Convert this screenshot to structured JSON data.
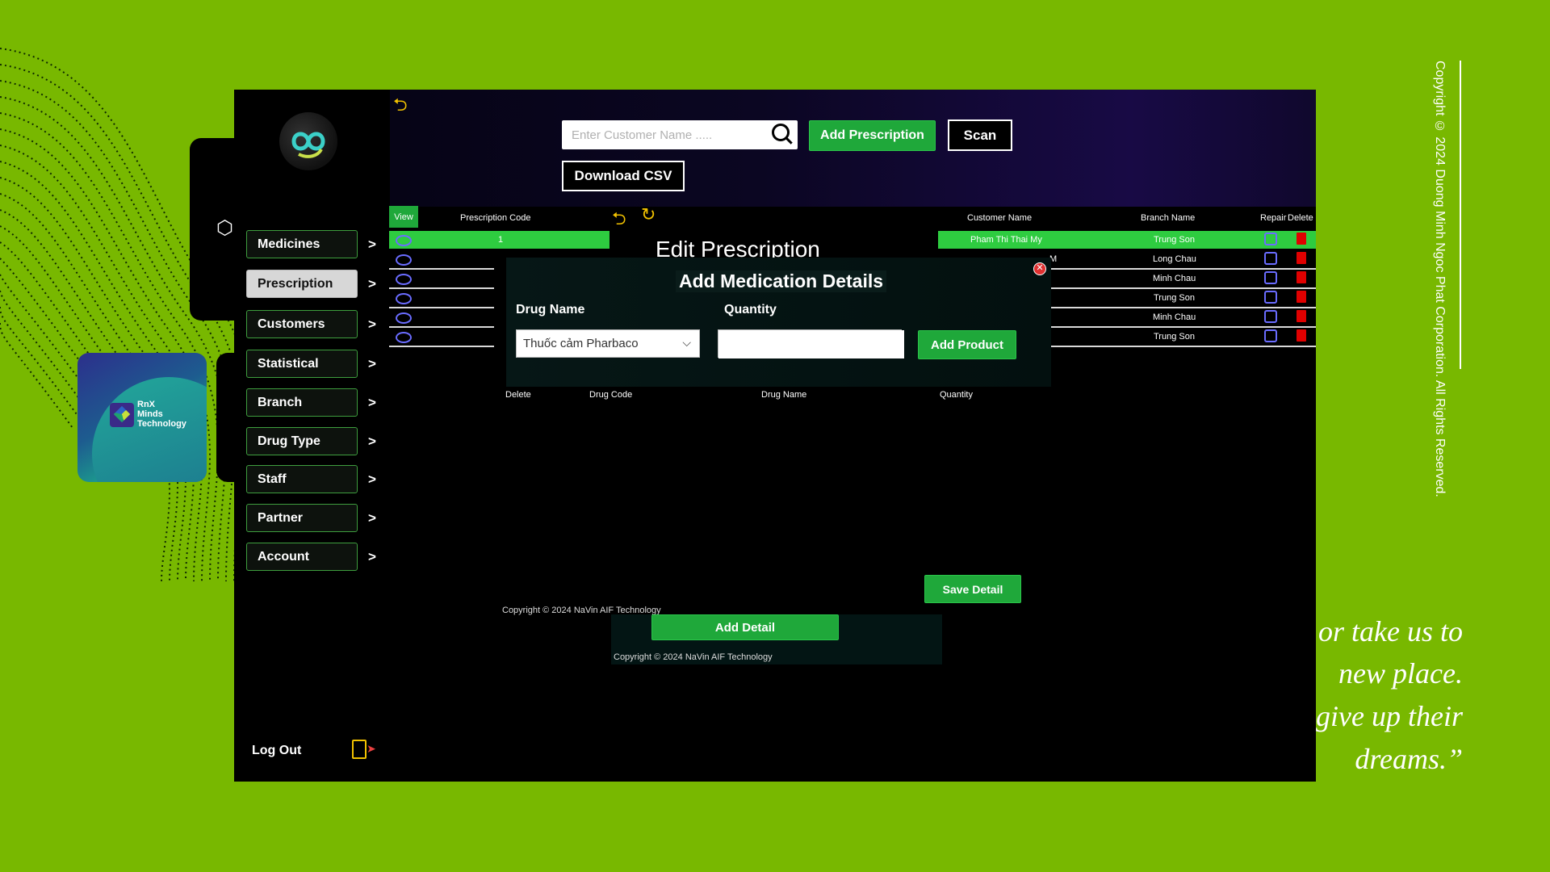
{
  "colors": {
    "background": "#78b800",
    "accent_green": "#1fa83a",
    "row_highlight": "#2ecc40",
    "delete_red": "#e00000",
    "edit_blue": "#6a6cff"
  },
  "brand": {
    "name_line1": "RnX",
    "name_line2": "Minds",
    "name_line3": "Technology"
  },
  "header": {
    "search_placeholder": "Enter Customer Name .....",
    "add_prescription_label": "Add Prescription",
    "scan_label": "Scan",
    "download_csv_label": "Download CSV"
  },
  "sidebar": {
    "items": [
      {
        "label": "Medicines",
        "arrow": ">"
      },
      {
        "label": "Prescription",
        "arrow": ">"
      },
      {
        "label": "Customers",
        "arrow": ">"
      },
      {
        "label": "Statistical",
        "arrow": ">"
      },
      {
        "label": "Branch",
        "arrow": ">"
      },
      {
        "label": "Drug Type",
        "arrow": ">"
      },
      {
        "label": "Staff",
        "arrow": ">"
      },
      {
        "label": "Partner",
        "arrow": ">"
      },
      {
        "label": "Account",
        "arrow": ">"
      }
    ],
    "logout_label": "Log Out"
  },
  "prescription_table": {
    "headers": {
      "view": "View",
      "code": "Prescription Code"
    },
    "first_code": "1"
  },
  "customer_table": {
    "headers": {
      "customer": "Customer Name",
      "branch": "Branch Name",
      "repair": "Repair",
      "delete": "Delete"
    },
    "rows": [
      {
        "customer": "Pham Thi Thai My",
        "branch": "Trung Son"
      },
      {
        "customer": "M",
        "branch": "Long Chau"
      },
      {
        "customer": "",
        "branch": "Minh Chau"
      },
      {
        "customer": "",
        "branch": "Trung Son"
      },
      {
        "customer": "",
        "branch": "Minh Chau"
      },
      {
        "customer": "",
        "branch": "Trung Son"
      }
    ]
  },
  "edit_panel": {
    "title": "Edit Prescription",
    "detail_headers": {
      "delete": "Delete",
      "drug_code": "Drug Code",
      "drug_name": "Drug Name",
      "quantity": "Quantity"
    },
    "save_detail_label": "Save Detail",
    "add_detail_label": "Add Detail",
    "copyright": "Copyright © 2024 NaVin AIF Technology"
  },
  "modal": {
    "title": "Add Medication Details",
    "drug_name_label": "Drug Name",
    "quantity_label": "Quantity",
    "drug_selected": "Thuốc cảm Pharbaco",
    "quantity_value": "",
    "add_product_label": "Add Product"
  },
  "footer_copyright": "Copyright © 2024 NaVin AIF Technology",
  "right_text": {
    "vertical_copyright": "Copyright © 2024 Duong Minh Ngoc Phat Corporation. All Rights Reserved.",
    "quote_lines": [
      "or take us to",
      "new place.",
      "give up their",
      "dreams.”"
    ]
  }
}
